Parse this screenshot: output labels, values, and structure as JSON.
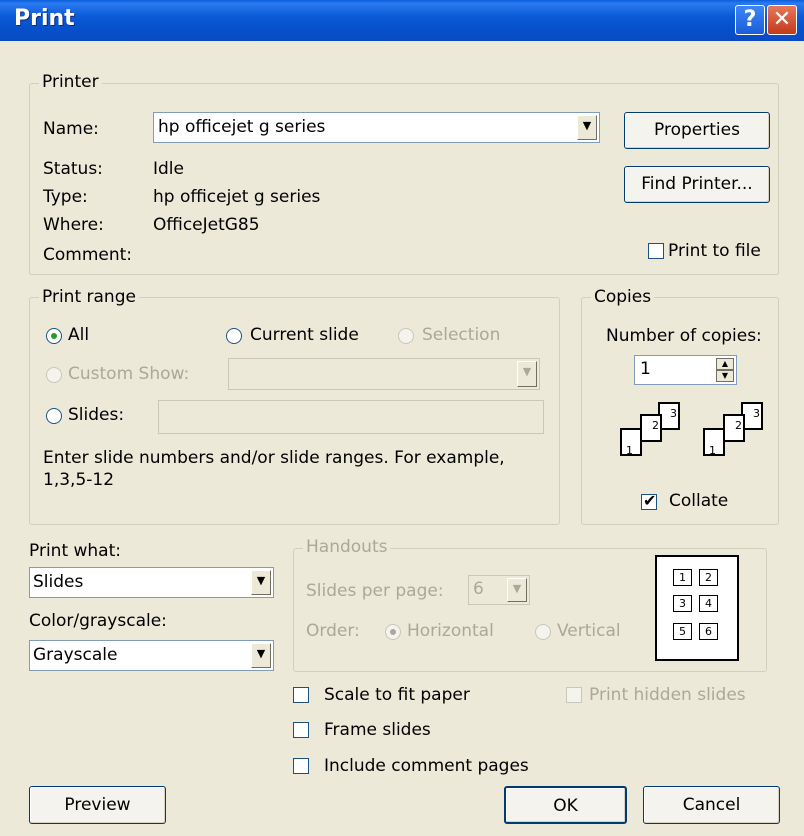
{
  "window": {
    "title": "Print"
  },
  "titlebar": {
    "help_glyph": "?",
    "close_glyph": "✕"
  },
  "printer": {
    "legend": "Printer",
    "name_label": "Name:",
    "name_value": "hp officejet g series",
    "status_label": "Status:",
    "status_value": "Idle",
    "type_label": "Type:",
    "type_value": "hp officejet g series",
    "where_label": "Where:",
    "where_value": "OfficeJetG85",
    "comment_label": "Comment:",
    "properties_label": "Properties",
    "find_printer_label": "Find Printer...",
    "print_to_file_label": "Print to file",
    "print_to_file_checked": false
  },
  "print_range": {
    "legend": "Print range",
    "all_label": "All",
    "current_slide_label": "Current slide",
    "selection_label": "Selection",
    "custom_show_label": "Custom Show:",
    "slides_label": "Slides:",
    "slides_value": "",
    "help_text_line1": "Enter slide numbers and/or slide ranges. For example,",
    "help_text_line2": "1,3,5-12",
    "selected": "All"
  },
  "copies": {
    "legend": "Copies",
    "number_label": "Number of copies:",
    "number_value": "1",
    "collate_label": "Collate",
    "collate_checked": true,
    "page_numbers": [
      "1",
      "2",
      "3"
    ]
  },
  "print_what": {
    "label": "Print what:",
    "value": "Slides",
    "color_label": "Color/grayscale:",
    "color_value": "Grayscale"
  },
  "handouts": {
    "legend": "Handouts",
    "slides_per_page_label": "Slides per page:",
    "slides_per_page_value": "6",
    "order_label": "Order:",
    "horizontal_label": "Horizontal",
    "vertical_label": "Vertical",
    "preview_numbers": [
      "1",
      "2",
      "3",
      "4",
      "5",
      "6"
    ]
  },
  "options": {
    "scale_to_fit_label": "Scale to fit paper",
    "frame_slides_label": "Frame slides",
    "include_comment_label": "Include comment pages",
    "print_hidden_label": "Print hidden slides"
  },
  "buttons": {
    "preview": "Preview",
    "ok": "OK",
    "cancel": "Cancel"
  }
}
